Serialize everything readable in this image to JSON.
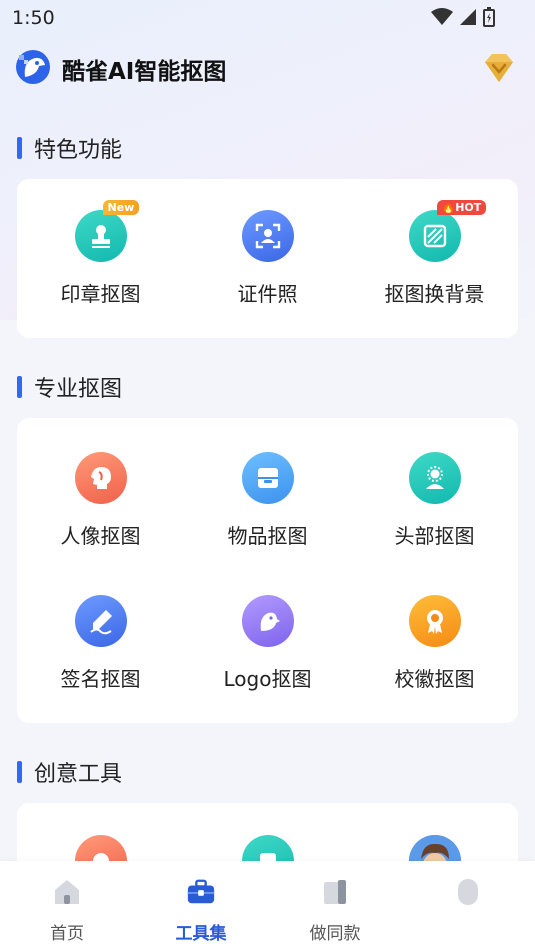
{
  "status": {
    "time": "1:50"
  },
  "header": {
    "title": "酷雀AI智能抠图"
  },
  "sections": [
    {
      "title": "特色功能",
      "tools": [
        {
          "label": "印章抠图",
          "icon": "stamp-icon",
          "tag": "New"
        },
        {
          "label": "证件照",
          "icon": "id-photo-icon",
          "tag": ""
        },
        {
          "label": "抠图换背景",
          "icon": "background-swap-icon",
          "tag": "HOT"
        }
      ]
    },
    {
      "title": "专业抠图",
      "tools": [
        {
          "label": "人像抠图",
          "icon": "portrait-icon"
        },
        {
          "label": "物品抠图",
          "icon": "product-box-icon"
        },
        {
          "label": "头部抠图",
          "icon": "head-icon"
        },
        {
          "label": "签名抠图",
          "icon": "signature-pen-icon"
        },
        {
          "label": "Logo抠图",
          "icon": "logo-bird-icon"
        },
        {
          "label": "校徽抠图",
          "icon": "badge-medal-icon"
        }
      ]
    },
    {
      "title": "创意工具",
      "tools": [
        {
          "label": "",
          "icon": "creative-tool-1-icon"
        },
        {
          "label": "",
          "icon": "creative-tool-2-icon"
        },
        {
          "label": "",
          "icon": "avatar-cartoon-icon"
        }
      ]
    }
  ],
  "nav": {
    "items": [
      {
        "label": "首页",
        "icon": "home-icon"
      },
      {
        "label": "工具集",
        "icon": "toolbox-icon",
        "active": true
      },
      {
        "label": "做同款",
        "icon": "template-icon"
      },
      {
        "label": "",
        "icon": "profile-icon"
      }
    ]
  },
  "colors": {
    "accent": "#2f6bf2",
    "active_nav": "#2a5bd7"
  }
}
